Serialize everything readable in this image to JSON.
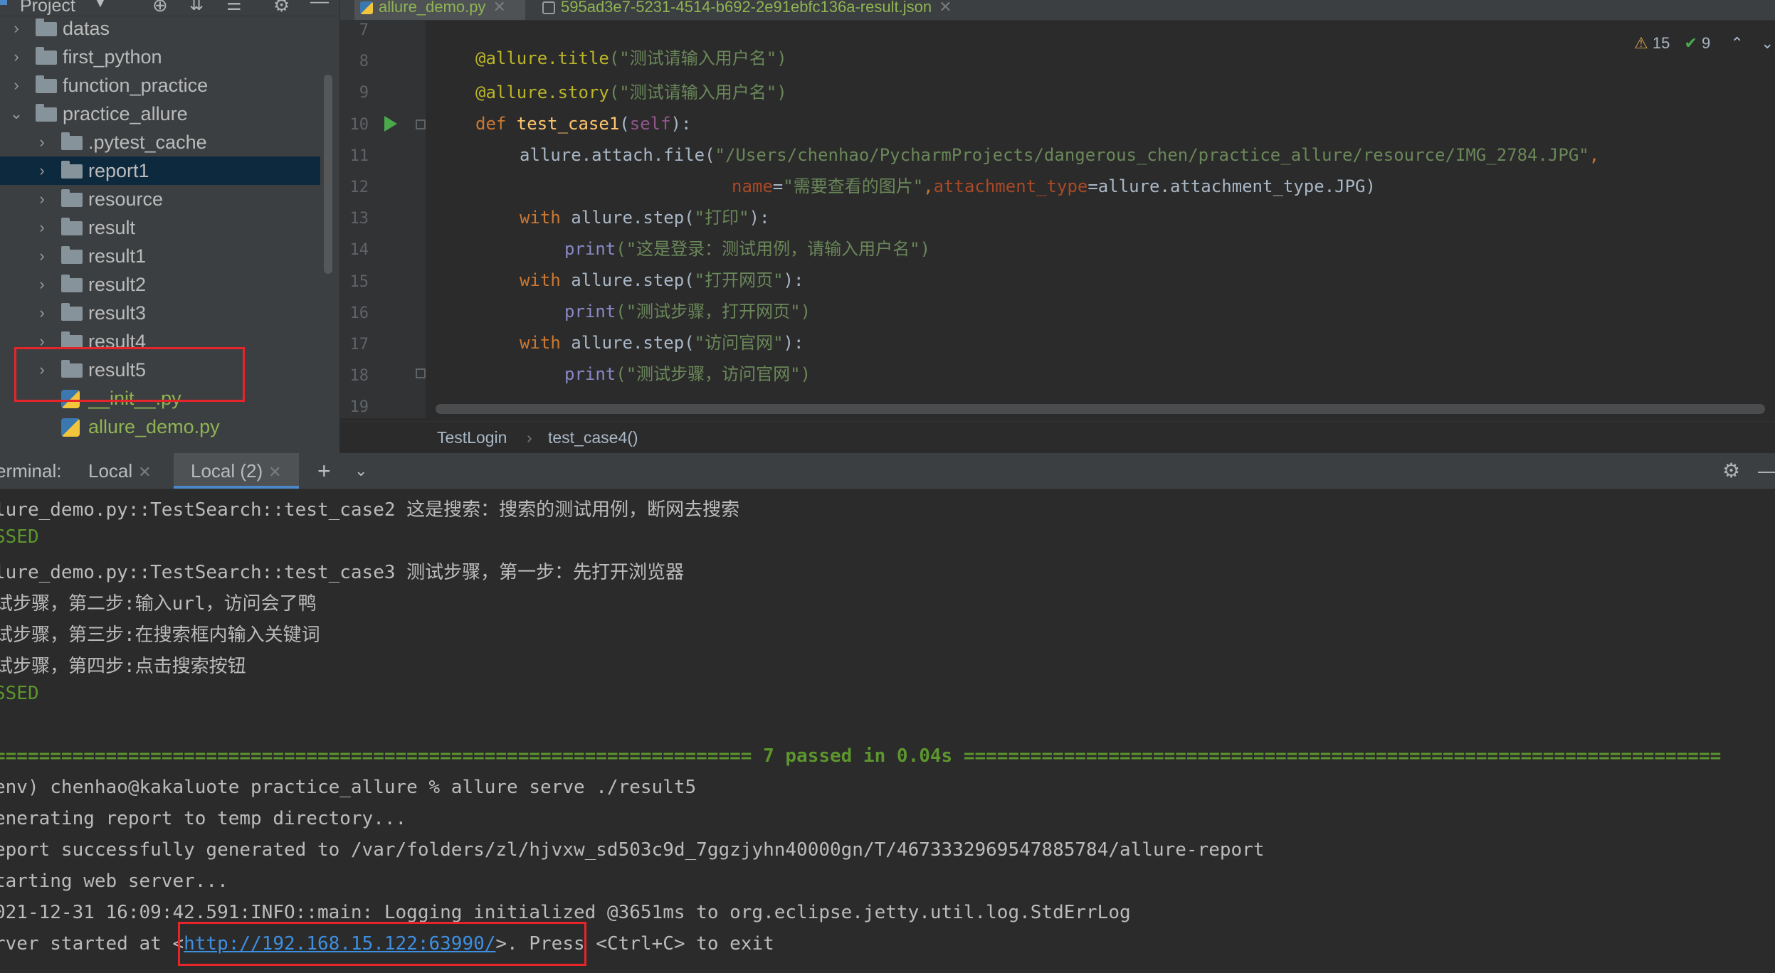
{
  "project_panel": {
    "title": "Project",
    "toolbar_icons": [
      "locate-icon",
      "expand-all-icon",
      "collapse-all-icon",
      "gear-icon",
      "minimize-icon"
    ],
    "items": [
      {
        "label": "datas",
        "type": "folder",
        "expanded": false
      },
      {
        "label": "first_python",
        "type": "folder",
        "expanded": false
      },
      {
        "label": "function_practice",
        "type": "folder",
        "expanded": false
      },
      {
        "label": "practice_allure",
        "type": "folder",
        "expanded": true
      },
      {
        "label": ".pytest_cache",
        "type": "folder",
        "expanded": false
      },
      {
        "label": "report1",
        "type": "folder",
        "expanded": false,
        "selected": true
      },
      {
        "label": "resource",
        "type": "folder",
        "expanded": false
      },
      {
        "label": "result",
        "type": "folder",
        "expanded": false
      },
      {
        "label": "result1",
        "type": "folder",
        "expanded": false
      },
      {
        "label": "result2",
        "type": "folder",
        "expanded": false
      },
      {
        "label": "result3",
        "type": "folder",
        "expanded": false
      },
      {
        "label": "result4",
        "type": "folder",
        "expanded": false
      },
      {
        "label": "result5",
        "type": "folder",
        "expanded": false
      },
      {
        "label": "__init__.py",
        "type": "python-file"
      },
      {
        "label": "allure_demo.py",
        "type": "python-file"
      }
    ]
  },
  "editor": {
    "tabs": [
      {
        "label": "allure_demo.py",
        "active": true
      },
      {
        "label": "595ad3e7-5231-4514-b692-2e91ebfc136a-result.json",
        "active": false
      }
    ],
    "warnings_count": "15",
    "ok_count": "9",
    "line_numbers": [
      "7",
      "8",
      "9",
      "10",
      "11",
      "12",
      "13",
      "14",
      "15",
      "16",
      "17",
      "18",
      "19"
    ],
    "code": {
      "l8_deco": "@allure.title",
      "l8_arg": "(\"测试请输入用户名\")",
      "l9_deco": "@allure.story",
      "l9_arg": "(\"测试请输入用户名\")",
      "l10_def": "def ",
      "l10_name": "test_case1",
      "l10_open": "(",
      "l10_self": "self",
      "l10_close": "):",
      "l11_a": "allure.attach.file(",
      "l11_path": "\"/Users/chenhao/PycharmProjects/dangerous_chen/practice_allure/resource/IMG_2784.JPG\"",
      "l11_comma": ",",
      "l12_name_kw": "name",
      "l12_eq": "=",
      "l12_name_val": "\"需要查看的图片\"",
      "l12_comma": ",",
      "l12_att_kw": "attachment_type",
      "l12_rest": "=allure.attachment_type.JPG)",
      "l13_with": "with ",
      "l13_rest": "allure.step(",
      "l13_str": "\"打印\"",
      "l13_end": "):",
      "l14_print": "print",
      "l14_str": "(\"这是登录：测试用例，请输入用户名\")",
      "l15_with": "with ",
      "l15_rest": "allure.step(",
      "l15_str": "\"打开网页\"",
      "l15_end": "):",
      "l16_print": "print",
      "l16_str": "(\"测试步骤，打开网页\")",
      "l17_with": "with ",
      "l17_rest": "allure.step(",
      "l17_str": "\"访问官网\"",
      "l17_end": "):",
      "l18_print": "print",
      "l18_str": "(\"测试步骤，访问官网\")"
    },
    "breadcrumb": [
      "TestLogin",
      "test_case4()"
    ]
  },
  "terminal": {
    "label": "erminal:",
    "tabs": [
      {
        "label": "Local",
        "active": false
      },
      {
        "label": "Local (2)",
        "active": true
      }
    ],
    "lines": [
      "lure_demo.py::TestSearch::test_case2 这是搜索：搜索的测试用例，断网去搜索",
      "SSED",
      "lure_demo.py::TestSearch::test_case3 测试步骤，第一步：先打开浏览器",
      "试步骤，第二步:输入url，访问会了鸭",
      "试步骤，第三步:在搜索框内输入关键词",
      "试步骤，第四步:点击搜索按钮",
      "SSED",
      "",
      "==================================================================== 7 passed in 0.04s ====================================================================",
      "env) chenhao@kakaluote practice_allure % allure serve ./result5",
      "enerating report to temp directory...",
      "eport successfully generated to /var/folders/zl/hjvxw_sd503c9d_7ggzjyhn40000gn/T/4673332969547885784/allure-report",
      "tarting web server...",
      "021-12-31 16:09:42.591:INFO::main: Logging initialized @3651ms to org.eclipse.jetty.util.log.StdErrLog"
    ],
    "server_prefix": "rver started at <",
    "server_url": "http://192.168.15.122:63990/",
    "server_suffix": ">. Press <Ctrl+C> to exit"
  },
  "colors": {
    "highlight_box": "#e5252a",
    "selected_row": "#0d293e",
    "link": "#3e8fe0",
    "passed": "#5c962c"
  }
}
